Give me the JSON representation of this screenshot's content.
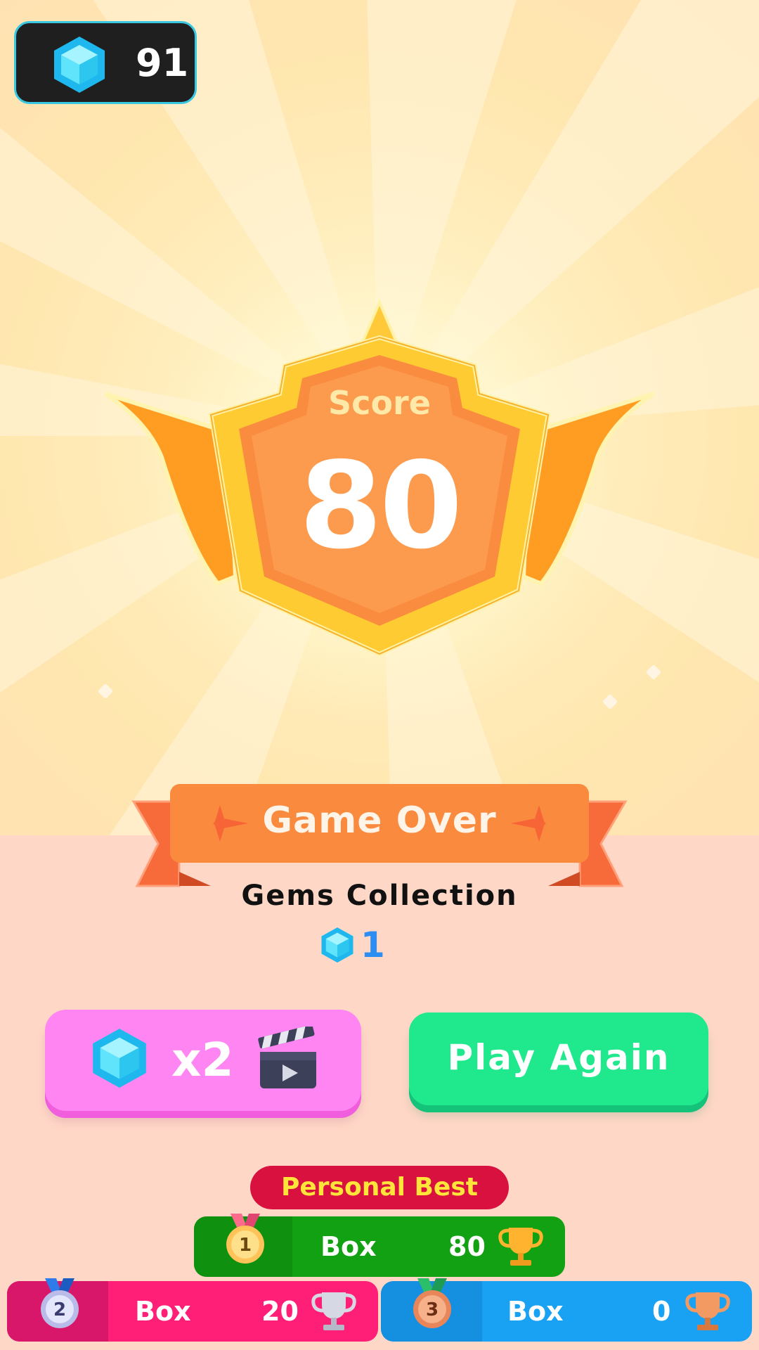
{
  "hud": {
    "gem_count": "91"
  },
  "result": {
    "score_label": "Score",
    "score_value": "80",
    "banner": "Game Over",
    "gems_title": "Gems Collection",
    "gems_collected": "1"
  },
  "buttons": {
    "double_reward_label": "x2",
    "play_again_label": "Play Again"
  },
  "leaderboard": {
    "title": "Personal Best",
    "entries": [
      {
        "rank": "1",
        "name": "Box",
        "score": "80"
      },
      {
        "rank": "2",
        "name": "Box",
        "score": "20"
      },
      {
        "rank": "3",
        "name": "Box",
        "score": "0"
      }
    ]
  },
  "colors": {
    "gold": "#ffc93a",
    "badge_orange": "#f98c3f",
    "wing_orange": "#ff9d22",
    "ribbon": "#f98a3e",
    "double_button": "#ff86f2",
    "play_button": "#1fe98c",
    "first_place": "#12a112",
    "second_place": "#ff1f77",
    "third_place": "#19a1f4",
    "gem": "#3fd2f7"
  },
  "icons": [
    "gem-icon",
    "clapperboard-icon",
    "trophy-icon",
    "medal-icon",
    "sparkle-icon"
  ]
}
